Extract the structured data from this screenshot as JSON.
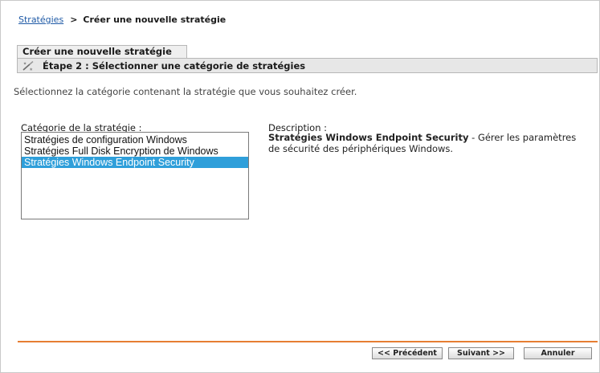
{
  "breadcrumb": {
    "link": "Stratégies",
    "separator": ">",
    "current": "Créer une nouvelle stratégie"
  },
  "wizard": {
    "tab_title": "Créer une nouvelle stratégie",
    "step_title": "Étape 2 : Sélectionner une catégorie de stratégies",
    "step_icon": "wand-icon"
  },
  "instruction": "Sélectionnez la catégorie contenant la stratégie que vous souhaitez créer.",
  "category": {
    "label": "Catégorie de la stratégie :",
    "items": [
      {
        "label": "Stratégies de configuration Windows",
        "selected": false
      },
      {
        "label": "Stratégies Full Disk Encryption de Windows",
        "selected": false
      },
      {
        "label": "Stratégies Windows Endpoint Security",
        "selected": true
      }
    ]
  },
  "description": {
    "label": "Description :",
    "bold": "Stratégies Windows Endpoint Security",
    "text": " - Gérer les paramètres de sécurité des périphériques Windows."
  },
  "buttons": {
    "previous": "<< Précédent",
    "next": "Suivant >>",
    "cancel": "Annuler"
  },
  "colors": {
    "selection": "#2f9fda",
    "divider": "#e67e33",
    "link": "#1f5aa6"
  }
}
